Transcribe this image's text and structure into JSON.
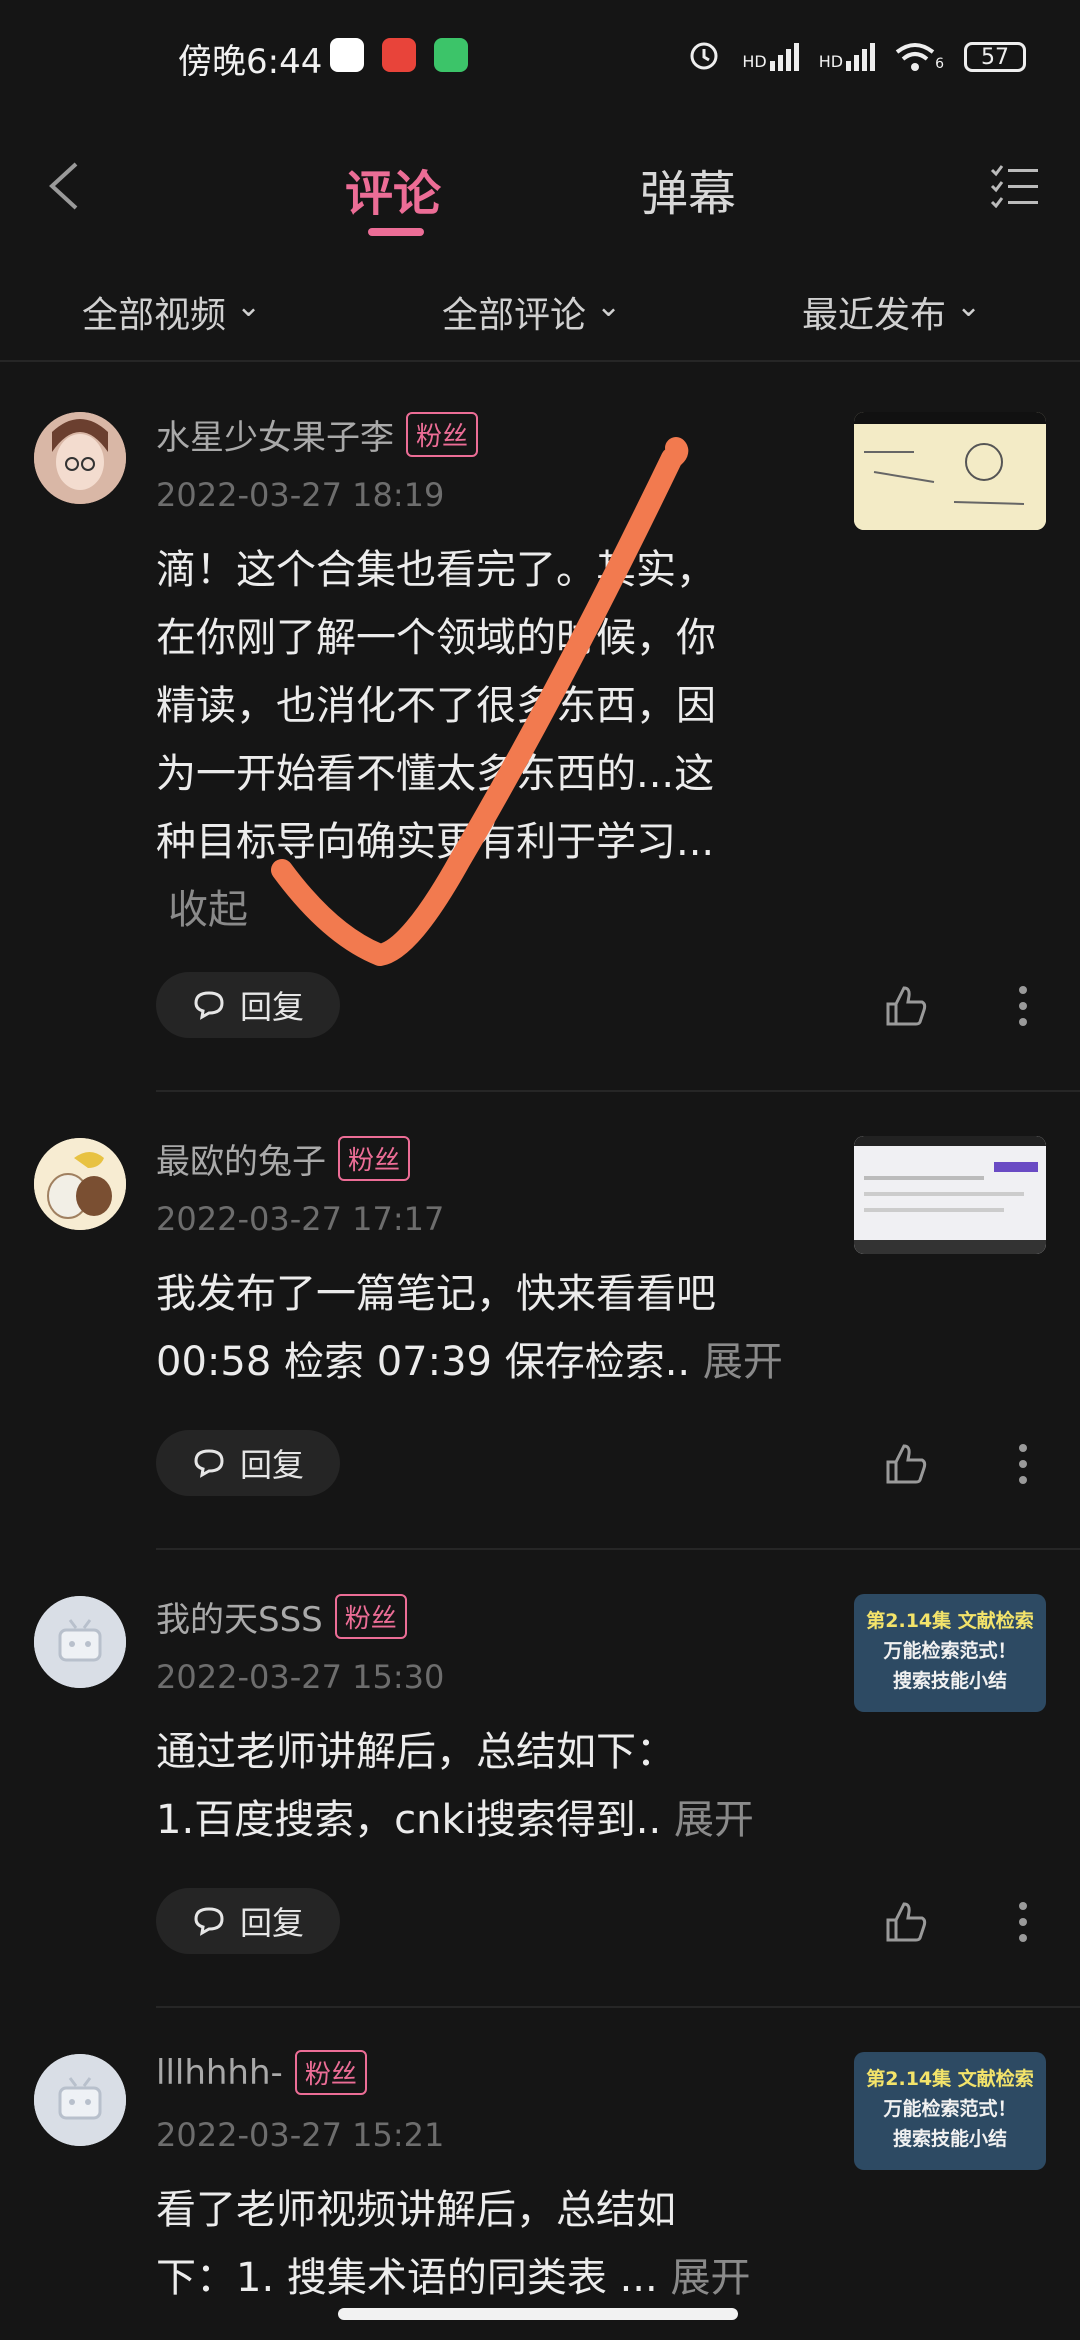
{
  "status_bar": {
    "time": "傍晚6:44",
    "network1": "HD",
    "network2": "HD",
    "wifi_label": "6",
    "battery": "57"
  },
  "header": {
    "tab_comments": "评论",
    "tab_danmaku": "弹幕"
  },
  "filters": {
    "video": "全部视频",
    "comments": "全部评论",
    "sort": "最近发布",
    "chevron": "⌄"
  },
  "comments": [
    {
      "user": "水星少女果子李",
      "badge": "粉丝",
      "date": "2022-03-27 18:19",
      "line1": "滴！这个合集也看完了。其实，",
      "line2": "在你刚了解一个领域的时候，你",
      "line3": "精读，也消化不了很多东西，因",
      "line4": "为一开始看不懂太多东西的...这",
      "line5": "种目标导向确实更有利于学习...",
      "collapse": "收起",
      "reply": "回复"
    },
    {
      "user": "最欧的兔子",
      "badge": "粉丝",
      "date": "2022-03-27 17:17",
      "line1": "我发布了一篇笔记，快来看看吧",
      "line2": "00:58 检索 07:39 保存检索..",
      "expand": "展开",
      "reply": "回复"
    },
    {
      "user": "我的天SSS",
      "badge": "粉丝",
      "date": "2022-03-27 15:30",
      "line1": "通过老师讲解后，总结如下：",
      "line2": "1.百度搜索，cnki搜索得到..",
      "expand": "展开",
      "reply": "回复",
      "thumb_line1": "第2.14集 文献检索",
      "thumb_line2": "万能检索范式！",
      "thumb_line3": "搜索技能小结"
    },
    {
      "user": "lllhhhh-",
      "badge": "粉丝",
      "date": "2022-03-27 15:21",
      "line1": "看了老师视频讲解后，总结如",
      "line2": "下：1. 搜集术语的同类表 ...",
      "expand": "展开",
      "thumb_line1": "第2.14集 文献检索",
      "thumb_line2": "万能检索范式！",
      "thumb_line3": "搜索技能小结"
    }
  ],
  "colors": {
    "accent": "#ec6d96",
    "background": "#151515",
    "annotation": "#f27a4f"
  }
}
